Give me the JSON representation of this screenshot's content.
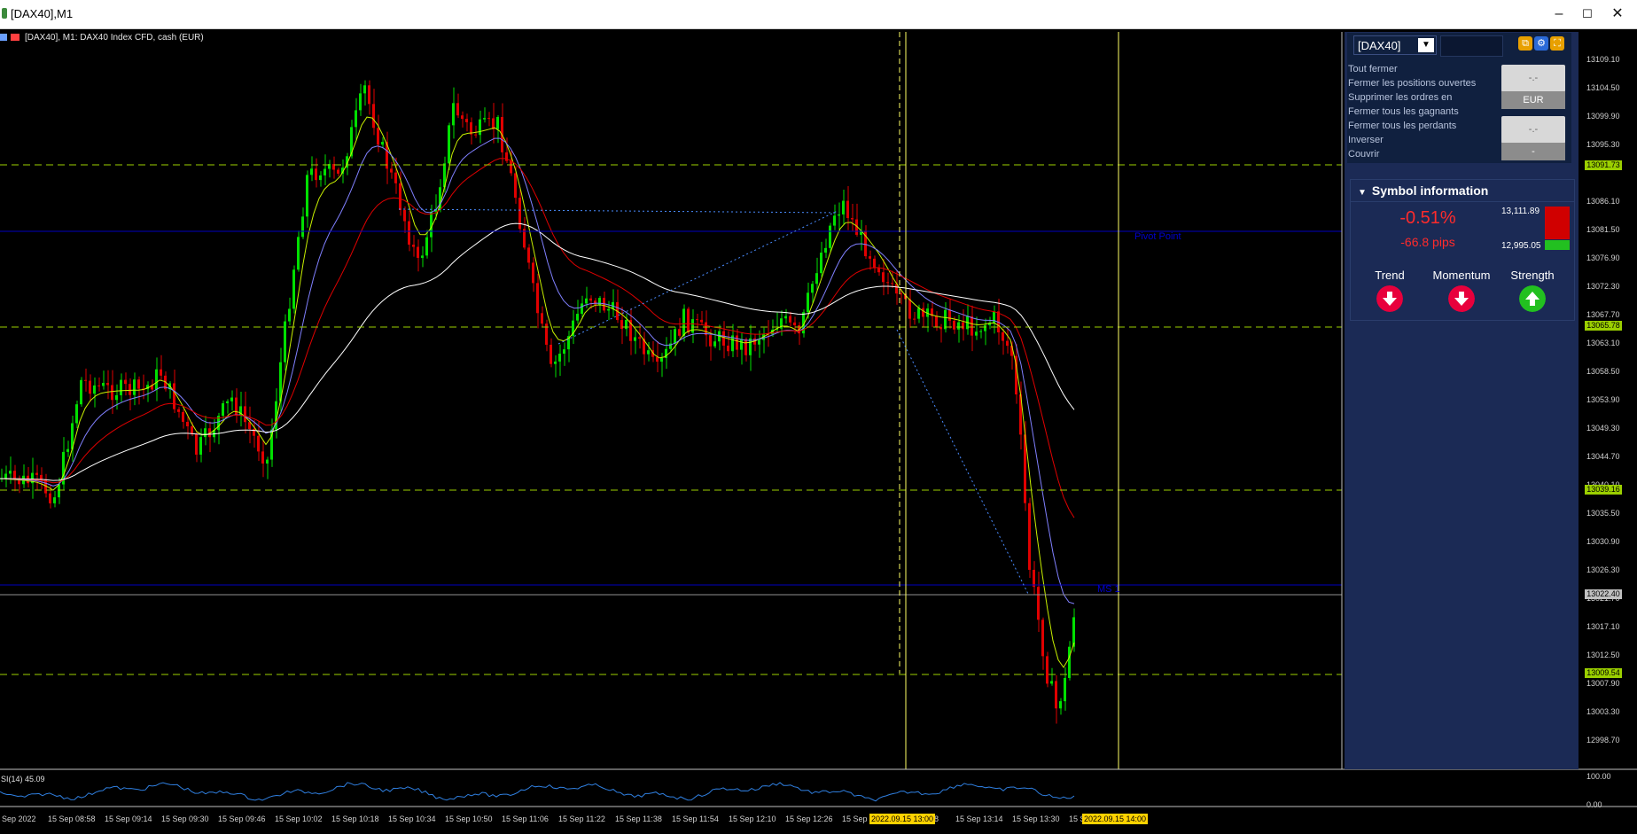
{
  "window": {
    "title": "[DAX40],M1"
  },
  "chart_header": {
    "text": "[DAX40], M1:  DAX40 Index CFD, cash (EUR)"
  },
  "colors": {
    "background": "#000000",
    "bull": "#00e000",
    "bear": "#e00000",
    "panel": "#1b2a55",
    "level_line": "#9bcf00",
    "pivot_line": "#0000c0",
    "cursor_line": "#ffff66"
  },
  "trade_panel": {
    "symbol": "[DAX40]",
    "icons": [
      "copy-icon",
      "gear-icon",
      "expand-icon"
    ],
    "actions": [
      "Tout fermer",
      "Fermer les positions ouvertes",
      "Supprimer les ordres en",
      "Fermer tous les gagnants",
      "Fermer tous les perdants",
      "Inverser",
      "Couvrir"
    ],
    "box1_value": "-.-",
    "box1_currency": "EUR",
    "box2_value": "-.-",
    "box2_sub": "-"
  },
  "symbol_info": {
    "title": "Symbol information",
    "change_pct": "-0.51%",
    "change_pips": "-66.8 pips",
    "high": "13,111.89",
    "low": "12,995.05",
    "indicators": [
      {
        "label": "Trend",
        "direction": "down",
        "icon": "arrow-down-icon",
        "color": "#e8003c"
      },
      {
        "label": "Momentum",
        "direction": "down",
        "icon": "arrow-down-icon",
        "color": "#e8003c"
      },
      {
        "label": "Strength",
        "direction": "up",
        "icon": "arrow-up-icon",
        "color": "#22c020"
      }
    ]
  },
  "price_axis": {
    "ticks": [
      "13109.10",
      "13104.50",
      "13099.90",
      "13095.30",
      "13086.10",
      "13081.50",
      "13076.90",
      "13072.30",
      "13067.70",
      "13063.10",
      "13058.50",
      "13053.90",
      "13049.30",
      "13044.70",
      "13040.10",
      "13035.50",
      "13030.90",
      "13026.30",
      "13021.70",
      "13017.10",
      "13012.50",
      "13007.90",
      "13003.30",
      "12998.70"
    ],
    "tags": [
      {
        "text": "13091.73",
        "color": "#9bcf00"
      },
      {
        "text": "13065.78",
        "color": "#9bcf00"
      },
      {
        "text": "13039.16",
        "color": "#9bcf00"
      },
      {
        "text": "13022.40",
        "color": "#c0c0c0"
      },
      {
        "text": "13009.54",
        "color": "#9bcf00"
      }
    ]
  },
  "time_axis": {
    "labels": [
      "Sep 2022",
      "15 Sep 08:58",
      "15 Sep 09:14",
      "15 Sep 09:30",
      "15 Sep 09:46",
      "15 Sep 10:02",
      "15 Sep 10:18",
      "15 Sep 10:34",
      "15 Sep 10:50",
      "15 Sep 11:06",
      "15 Sep 11:22",
      "15 Sep 11:38",
      "15 Sep 11:54",
      "15 Sep 12:10",
      "15 Sep 12:26",
      "15 Sep",
      "8",
      "15 Sep 13:14",
      "15 Sep 13:30",
      "15 S"
    ],
    "cursor_tags": [
      "2022.09.15 13:00",
      "2022.09.15 14:00"
    ]
  },
  "levels": {
    "pivot_label": "Pivot Point",
    "s1_label": "MS 1"
  },
  "rsi": {
    "label": "SI(14) 45.09",
    "axis_top": "100.00",
    "axis_bottom": "0.00"
  }
}
